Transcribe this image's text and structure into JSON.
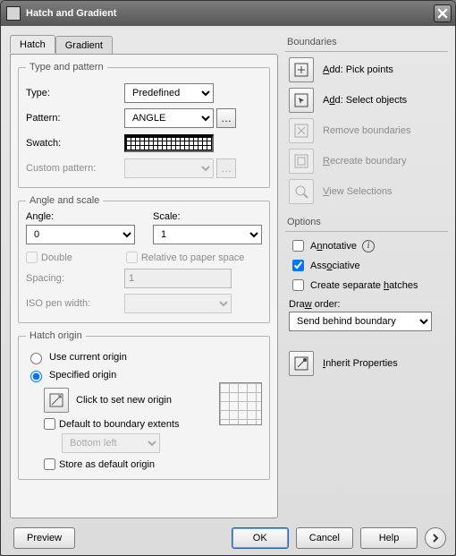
{
  "title": "Hatch and Gradient",
  "tabs": {
    "hatch": "Hatch",
    "gradient": "Gradient"
  },
  "type_pattern": {
    "legend": "Type and pattern",
    "type_label": "Type:",
    "type_value": "Predefined",
    "pattern_label": "Pattern:",
    "pattern_value": "ANGLE",
    "swatch_label": "Swatch:",
    "custom_label": "Custom pattern:",
    "custom_value": ""
  },
  "angle_scale": {
    "legend": "Angle and scale",
    "angle_label": "Angle:",
    "angle_value": "0",
    "scale_label": "Scale:",
    "scale_value": "1",
    "double_label": "Double",
    "relative_label": "Relative to paper space",
    "spacing_label": "Spacing:",
    "spacing_value": "1",
    "iso_label": "ISO pen width:",
    "iso_value": ""
  },
  "hatch_origin": {
    "legend": "Hatch origin",
    "use_current": "Use current origin",
    "specified": "Specified origin",
    "click_to_set": "Click to set new origin",
    "default_extents": "Default to boundary extents",
    "extents_value": "Bottom left",
    "store_default": "Store as default origin"
  },
  "boundaries": {
    "legend": "Boundaries",
    "pick": "Add: Pick points",
    "select": "Add: Select objects",
    "remove": "Remove boundaries",
    "recreate": "Recreate boundary",
    "view": "View Selections"
  },
  "options": {
    "legend": "Options",
    "annotative": "Annotative",
    "associative": "Associative",
    "separate": "Create separate hatches",
    "draworder_label": "Draw order:",
    "draworder_value": "Send behind boundary"
  },
  "inherit": "Inherit Properties",
  "footer": {
    "preview": "Preview",
    "ok": "OK",
    "cancel": "Cancel",
    "help": "Help"
  }
}
